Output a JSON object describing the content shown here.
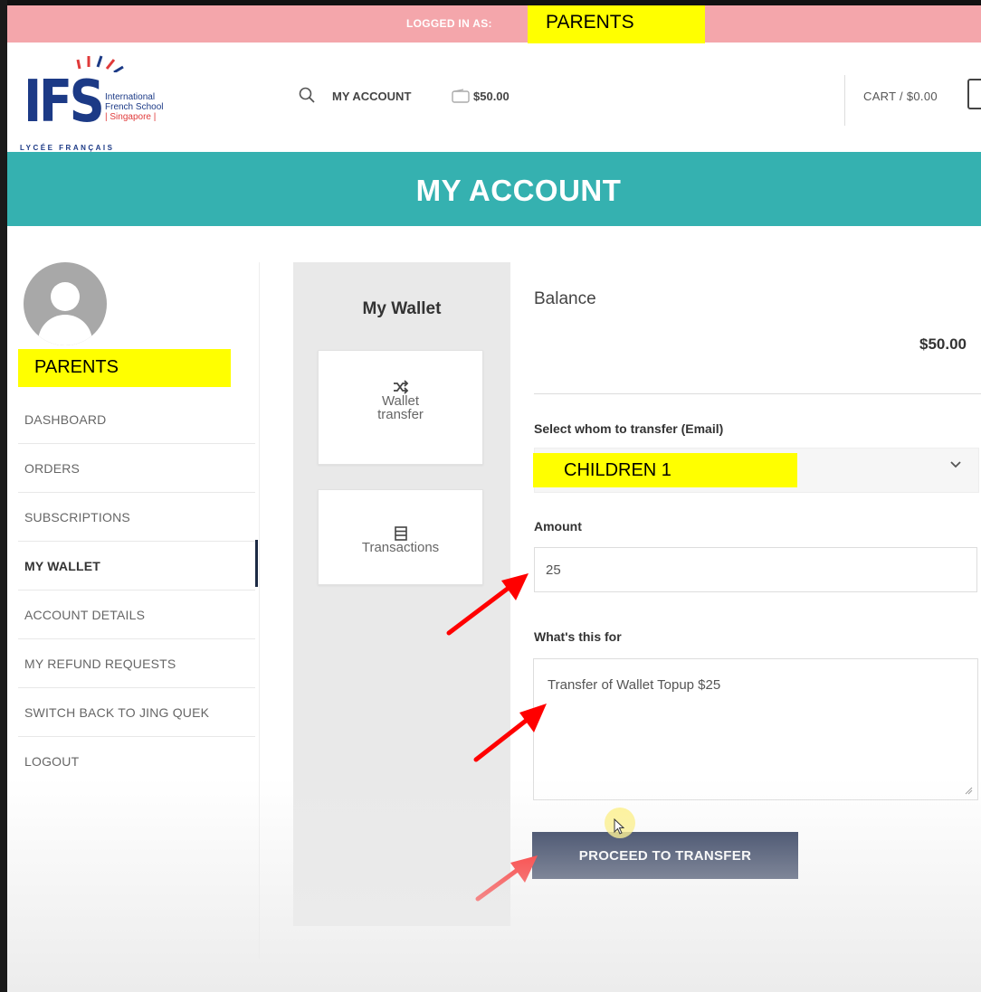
{
  "session": {
    "logged_in_label": "LOGGED IN AS:",
    "logged_in_user": "PARENTS"
  },
  "logo": {
    "mark": "IFS",
    "line1": "International",
    "line2": "French School",
    "line3": "| Singapore |",
    "tagline": "LYCÉE FRANÇAIS"
  },
  "header": {
    "search_icon": "search-icon",
    "my_account_label": "MY ACCOUNT",
    "wallet_amount": "$50.00",
    "cart_label": "CART / $0.00"
  },
  "banner": {
    "title": "MY ACCOUNT"
  },
  "sidebar": {
    "username": "PARENTS",
    "items": [
      {
        "label": "DASHBOARD"
      },
      {
        "label": "ORDERS"
      },
      {
        "label": "SUBSCRIPTIONS"
      },
      {
        "label": "MY WALLET",
        "active": true
      },
      {
        "label": "ACCOUNT DETAILS"
      },
      {
        "label": "MY REFUND REQUESTS"
      },
      {
        "label": "SWITCH BACK TO JING QUEK"
      },
      {
        "label": "LOGOUT"
      }
    ]
  },
  "wallet": {
    "title": "My Wallet",
    "tabs": [
      {
        "label_line1": "Wallet",
        "label_line2": "transfer",
        "icon": "shuffle-icon"
      },
      {
        "label_line1": "Transactions",
        "icon": "list-icon"
      }
    ]
  },
  "form": {
    "balance_label": "Balance",
    "balance_value": "$50.00",
    "recipient_label": "Select whom to transfer (Email)",
    "recipient_value": "CHILDREN 1",
    "amount_label": "Amount",
    "amount_value": "25",
    "purpose_label": "What's this for",
    "purpose_value": "Transfer of Wallet Topup $25",
    "submit_label": "PROCEED TO TRANSFER"
  },
  "colors": {
    "logged_bar": "#f4a6ab",
    "highlight": "#ffff00",
    "banner": "#35b1b0",
    "primary_button": "#1c2a4d",
    "annotation_arrow": "#ff0000",
    "logo_blue": "#1c3a86"
  }
}
